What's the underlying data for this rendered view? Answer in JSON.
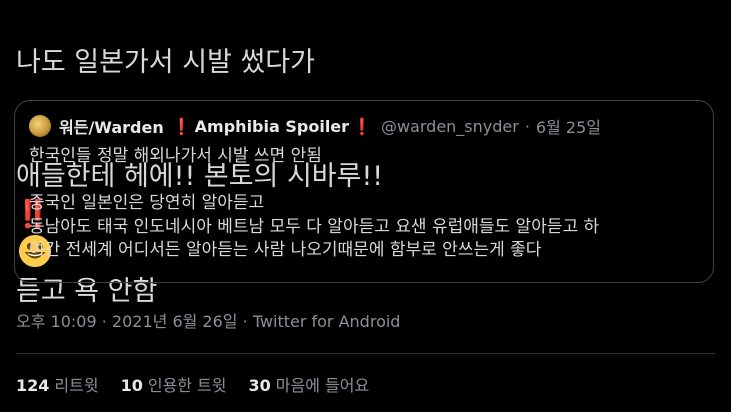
{
  "tweet": {
    "line1": "나도 일본가서 시발 썼다가",
    "line2_a": "애들한테 헤에!! 본토의 시바루!!",
    "line2_bang": "‼️",
    "line2_b": "듣고 욕 안함",
    "emoji_icon": "grinning-face-icon"
  },
  "quote": {
    "author_name": "워든/Warden",
    "spoiler_label": "Amphibia Spoiler",
    "bang_icon": "red-exclamation-icon",
    "handle": "@warden_snyder",
    "dot": "·",
    "date": "6월 25일",
    "lines": [
      "한국인들 정말 해외나가서 시발 쓰면 안됨",
      "",
      "중국인 일본인은 당연히 알아듣고",
      "동남아도 태국 인도네시아 베트남 모두 다 알아듣고 요샌 유럽애들도 알아듣고 하",
      "여간 전세계 어디서든 알아듣는 사람 나오기때문에 함부로 안쓰는게 좋다"
    ]
  },
  "meta": {
    "time": "오후 10:09",
    "sep1": "·",
    "date": "2021년 6월 26일",
    "sep2": "·",
    "source": "Twitter for Android"
  },
  "stats": {
    "retweets_count": "124",
    "retweets_label": "리트윗",
    "quotes_count": "10",
    "quotes_label": "인용한 트윗",
    "likes_count": "30",
    "likes_label": "마음에 들어요"
  },
  "colors": {
    "background": "#000000",
    "text": "#d9d9d9",
    "muted": "#8b8f94",
    "accent_red": "#e0245e",
    "border": "#3d4146"
  }
}
